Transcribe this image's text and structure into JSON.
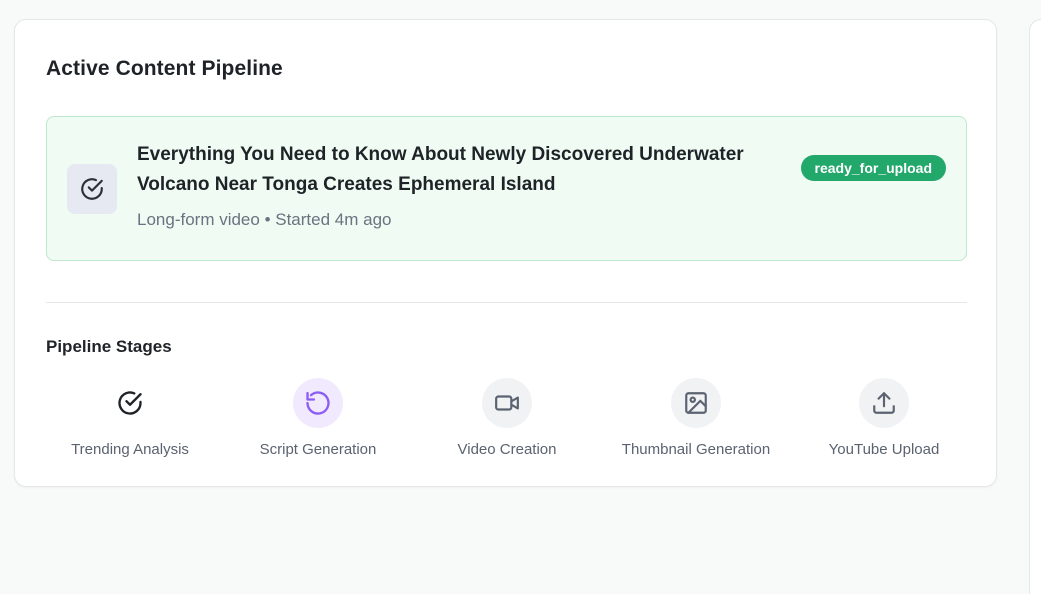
{
  "pipeline": {
    "title": "Active Content Pipeline",
    "active_item": {
      "title": "Everything You Need to Know About Newly Discovered Underwater Volcano Near Tonga Creates Ephemeral Island",
      "meta": "Long-form video • Started 4m ago",
      "status": "ready_for_upload",
      "icon": "check-circle-icon"
    },
    "stages_title": "Pipeline Stages",
    "stages": [
      {
        "label": "Trending Analysis",
        "state": "complete",
        "icon": "check-circle-icon"
      },
      {
        "label": "Script Generation",
        "state": "in-progress",
        "icon": "refresh-icon"
      },
      {
        "label": "Video Creation",
        "state": "pending",
        "icon": "video-camera-icon"
      },
      {
        "label": "Thumbnail Generation",
        "state": "pending",
        "icon": "image-icon"
      },
      {
        "label": "YouTube Upload",
        "state": "pending",
        "icon": "upload-icon"
      }
    ]
  },
  "colors": {
    "success": "#23a86b",
    "active_stage": "#8b5cf6",
    "pending_stage": "#6b7280"
  }
}
